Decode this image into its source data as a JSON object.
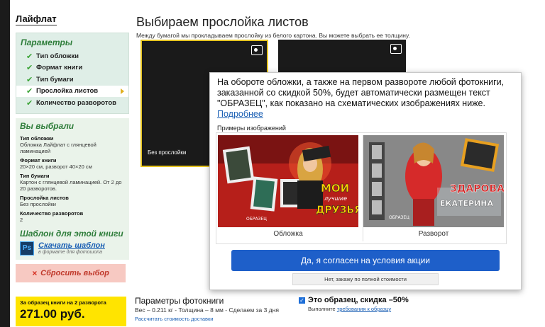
{
  "brand": "Лайфлат",
  "params": {
    "title": "Параметры",
    "items": [
      {
        "label": "Тип обложки",
        "active": false
      },
      {
        "label": "Формат книги",
        "active": false
      },
      {
        "label": "Тип бумаги",
        "active": false
      },
      {
        "label": "Прослойка листов",
        "active": true
      },
      {
        "label": "Количество разворотов",
        "active": false
      }
    ]
  },
  "chosen": {
    "title": "Вы выбрали",
    "items": [
      {
        "label": "Тип обложки",
        "value": "Обложка Лайфлат с глянцевой ламинацией"
      },
      {
        "label": "Формат книги",
        "value": "20×20 см, разворот 40×20 см"
      },
      {
        "label": "Тип бумаги",
        "value": "Картон с глянцевой ламинацией. От 2 до 20 разворотов."
      },
      {
        "label": "Прослойка листов",
        "value": "Без прослойки"
      },
      {
        "label": "Количество разворотов",
        "value": "2"
      }
    ]
  },
  "template": {
    "title": "Шаблон для этой книги",
    "icon_text": "Ps",
    "link": "Скачать шаблон",
    "sub": "в формате для фотошопа"
  },
  "reset": {
    "label": "Сбросить выбор",
    "icon": "×"
  },
  "price": {
    "label": "За образец книги на 2 разворота",
    "value": "271.00 руб."
  },
  "main": {
    "title": "Выбираем прослойка листов",
    "subtitle": "Между бумагой мы прокладываем прослойку из белого картона. Вы можете выбрать ее толщину.",
    "options": [
      {
        "label": "Без прослойки",
        "selected": true,
        "icon": "photo-icon"
      },
      {
        "label": "",
        "selected": false,
        "icon": "photo-icon"
      }
    ]
  },
  "bottom": {
    "title": "Параметры фотокниги",
    "spec": "Вес – 0.211 кг - Толщина – 8 мм - Сделаем за 3 дня",
    "link": "Рассчитать стоимость доставки",
    "sample_label": "Это образец, скидка –50%",
    "sample_sub": "Выполните",
    "sample_link": "требования к образцу",
    "sample_checked": true
  },
  "popup": {
    "text": "На обороте обложки, а также на первом развороте любой фотокниги, заказанной со скидкой 50%, будет автоматически размещен текст \"ОБРАЗЕЦ\", как показано на схематических изображениях ниже.",
    "more_link": "Подробнее",
    "examples_label": "Примеры изображений",
    "examples": [
      {
        "caption": "Обложка",
        "overlay1": "МОИ",
        "overlay2": "ДРУЗЬЯ",
        "overlay_small": "лучшие",
        "watermark": "ОБРАЗЕЦ"
      },
      {
        "caption": "Разворот",
        "overlay1": "ЗДАРОВА",
        "overlay2": "ЕКАТЕРИНА",
        "watermark": "ОБРАЗЕЦ"
      }
    ],
    "accept_label": "Да, я согласен на условия акции",
    "decline_label": "Нет, закажу по полной стоимости"
  },
  "colors": {
    "accent_green": "#2e7d3a",
    "primary_blue": "#1e5fc9",
    "price_yellow": "#ffe400",
    "reset_bg": "#f7c9c2"
  }
}
